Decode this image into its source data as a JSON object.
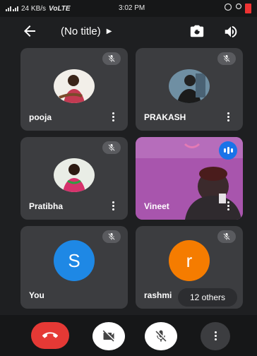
{
  "status": {
    "network": "24 KB/s",
    "volte": "VoLTE",
    "time": "3:02 PM"
  },
  "header": {
    "title": "(No title)"
  },
  "participants": [
    {
      "name": "pooja",
      "avatar": "photo"
    },
    {
      "name": "PRAKASH",
      "avatar": "photo"
    },
    {
      "name": "Pratibha",
      "avatar": "photo"
    },
    {
      "name": "Vineet",
      "avatar": "video"
    },
    {
      "name": "You",
      "avatar_letter": "S",
      "color": "#1e88e5"
    },
    {
      "name": "rashmi",
      "avatar_letter": "r",
      "color": "#f57c00"
    }
  ],
  "others_label": "12 others",
  "colors": {
    "end_call": "#e53935",
    "speaking_badge": "#1a73e8"
  },
  "icons": {
    "back": "arrow-left-icon",
    "switch_camera": "switch-camera-icon",
    "speaker": "speaker-icon",
    "mic_off": "mic-off-icon",
    "more": "more-vert-icon",
    "end_call": "call-end-icon",
    "camera_off": "camera-off-icon"
  }
}
